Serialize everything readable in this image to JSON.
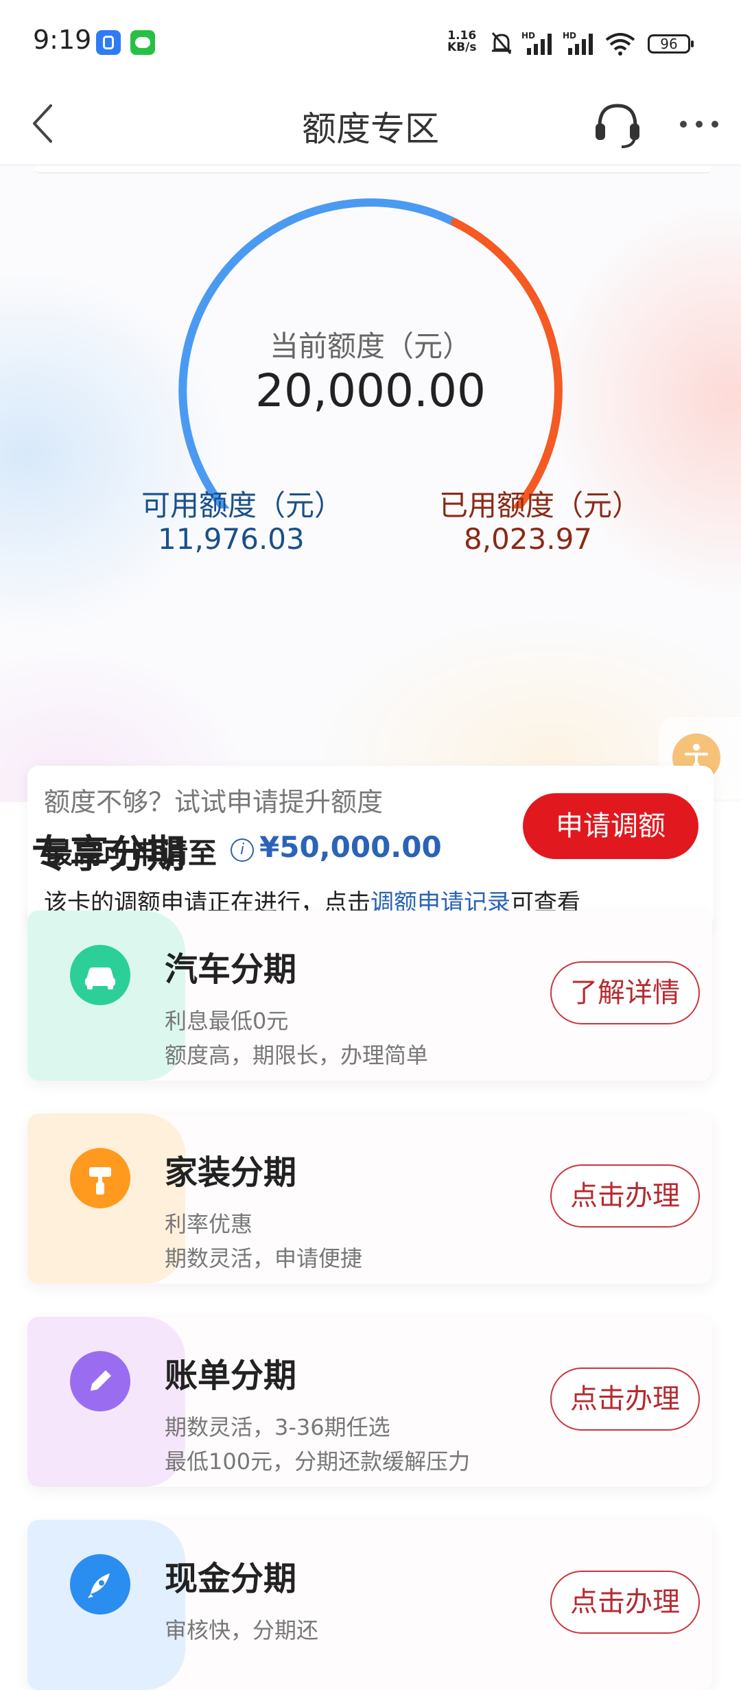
{
  "status_bar": {
    "time": "9:19",
    "net_speed_value": "1.16",
    "net_speed_unit": "KB/s",
    "battery": "96",
    "icons": [
      "app-badge-icon",
      "wechat-icon",
      "mute-bell-icon",
      "signal-hd-icon",
      "signal-hd-icon",
      "wifi-icon",
      "battery-icon"
    ]
  },
  "header": {
    "title": "额度专区",
    "icons": [
      "back-arrow-icon",
      "headset-icon",
      "more-dots-icon"
    ]
  },
  "credit": {
    "current_label": "当前额度（元）",
    "current_value": "20,000.00",
    "available_label": "可用额度（元）",
    "available_value": "11,976.03",
    "used_label": "已用额度（元）",
    "used_value": "8,023.97",
    "used_fraction": 0.4012,
    "colors": {
      "available": "#4b9af2",
      "used": "#f45a22"
    }
  },
  "raise": {
    "prompt": "额度不够？试试申请提升额度",
    "max_label": "最高可申请至",
    "max_value": "¥50,000.00",
    "apply_label": "申请调额",
    "note_prefix": "该卡的调额申请正在进行，点击",
    "note_link": "调额申请记录",
    "note_suffix": "可查看"
  },
  "installment": {
    "title": "专享分期",
    "items": [
      {
        "title": "汽车分期",
        "line1": "利息最低0元",
        "line2": "额度高，期限长，办理简单",
        "action": "了解详情",
        "icon": "car-icon",
        "color": "#2ccf97",
        "tint": "#dcf8ee"
      },
      {
        "title": "家装分期",
        "line1": "利率优惠",
        "line2": "期数灵活，申请便捷",
        "action": "点击办理",
        "icon": "paint-roller-icon",
        "color": "#ff9a1f",
        "tint": "#fff0dc"
      },
      {
        "title": "账单分期",
        "line1": "期数灵活，3-36期任选",
        "line2": "最低100元，分期还款缓解压力",
        "action": "点击办理",
        "icon": "pencil-icon",
        "color": "#9a6df0",
        "tint": "#f6e6fb"
      },
      {
        "title": "现金分期",
        "line1": "审核快，分期还",
        "line2": "",
        "action": "点击办理",
        "icon": "rocket-icon",
        "color": "#2a8df0",
        "tint": "#e2efff"
      }
    ]
  }
}
